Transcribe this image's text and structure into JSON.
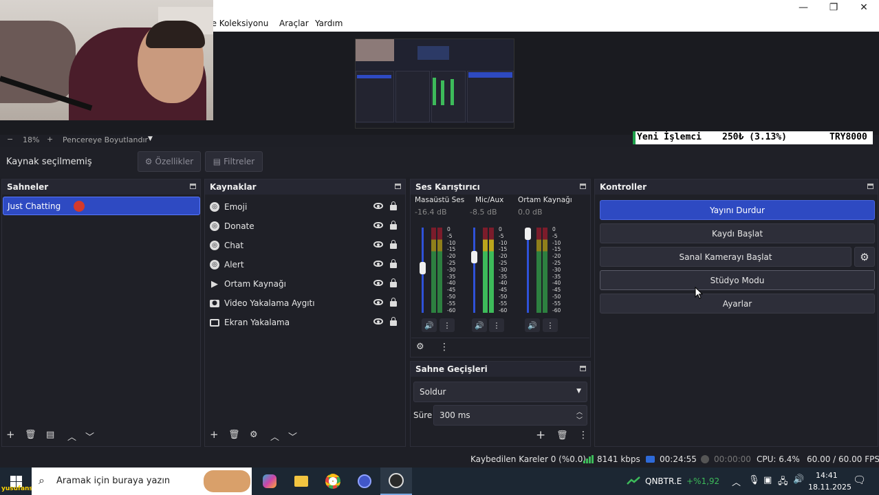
{
  "menu": {
    "scene_collection_partial": "ne Koleksiyonu",
    "tools": "Araçlar",
    "help": "Yardım"
  },
  "window": {
    "minimize": "—",
    "restore": "❐",
    "close": "✕"
  },
  "zoom": {
    "minus": "−",
    "percent": "18%",
    "plus": "+",
    "fit": "Pencereye Boyutlandır"
  },
  "ticker": {
    "name": "Yeni İşlemci",
    "change": "250₺ (3.13%)",
    "symbol": "TRY8000"
  },
  "source_bar": {
    "no_source": "Kaynak seçilmemiş",
    "properties": "Özellikler",
    "filters": "Filtreler"
  },
  "scenes": {
    "title": "Sahneler",
    "items": [
      "Just Chatting"
    ]
  },
  "sources": {
    "title": "Kaynaklar",
    "items": [
      {
        "label": "Emoji",
        "icon": "globe-icon"
      },
      {
        "label": "Donate",
        "icon": "globe-icon"
      },
      {
        "label": "Chat",
        "icon": "globe-icon"
      },
      {
        "label": "Alert",
        "icon": "globe-icon"
      },
      {
        "label": "Ortam Kaynağı",
        "icon": "play-icon"
      },
      {
        "label": "Video Yakalama Aygıtı",
        "icon": "camera-icon"
      },
      {
        "label": "Ekran Yakalama",
        "icon": "monitor-icon"
      }
    ]
  },
  "mixer": {
    "title": "Ses Karıştırıcı",
    "channels": [
      {
        "name": "Masaüstü Ses",
        "db": "-16.4 dB",
        "level": 0.5
      },
      {
        "name": "Mic/Aux",
        "db": "-8.5 dB",
        "level": 0.65
      },
      {
        "name": "Ortam Kaynağı",
        "db": "0.0 dB",
        "level": 1.0
      }
    ],
    "scale": [
      "0",
      "-5",
      "-10",
      "-15",
      "-20",
      "-25",
      "-30",
      "-35",
      "-40",
      "-45",
      "-50",
      "-55",
      "-60"
    ]
  },
  "transitions": {
    "title": "Sahne Geçişleri",
    "selected": "Soldur",
    "duration_label": "Süre",
    "duration_value": "300 ms"
  },
  "controls": {
    "title": "Kontroller",
    "stop_stream": "Yayını Durdur",
    "start_recording": "Kaydı Başlat",
    "start_virtual_camera": "Sanal Kamerayı Başlat",
    "studio_mode": "Stüdyo Modu",
    "settings": "Ayarlar"
  },
  "status": {
    "dropped_frames": "Kaybedilen Kareler 0 (%0.0)",
    "bitrate": "8141 kbps",
    "stream_time": "00:24:55",
    "record_time": "00:00:00",
    "cpu": "CPU: 6.4%",
    "fps": "60.00 / 60.00 FPS"
  },
  "taskbar": {
    "search_placeholder": "Aramak için buraya yazın",
    "stock_symbol": "QNBTR.E",
    "stock_change": "+%1,92",
    "time": "14:41",
    "date": "18.11.2025",
    "watermark": "yusufansy"
  }
}
